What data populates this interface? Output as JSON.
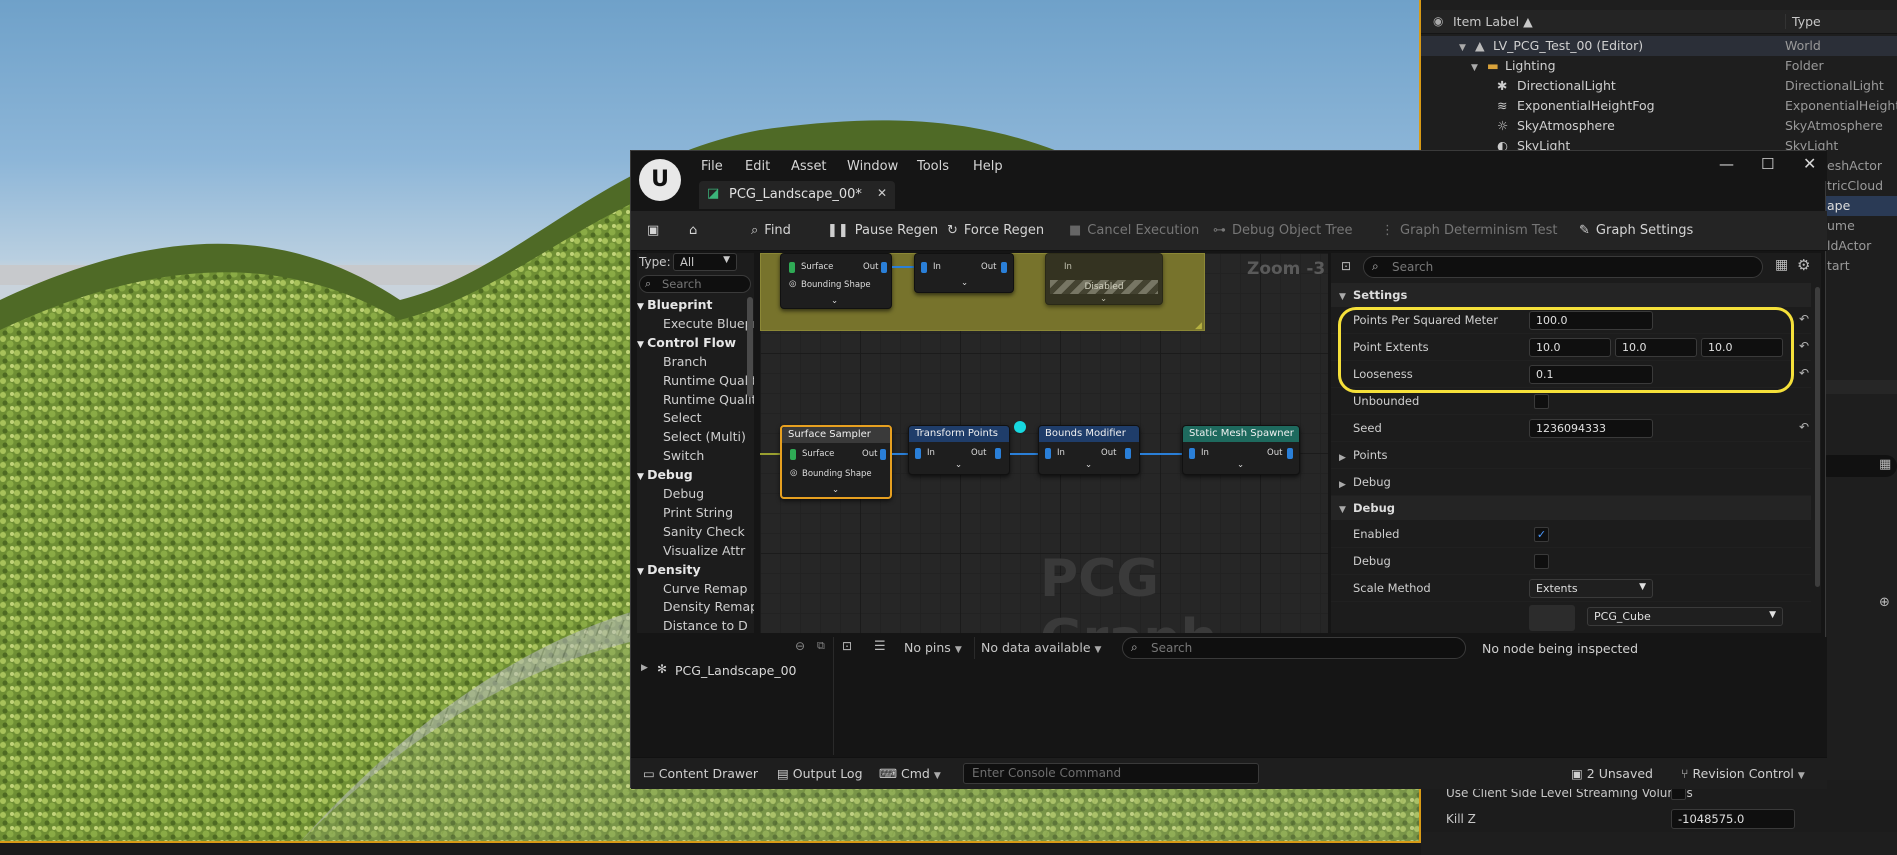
{
  "outliner": {
    "header": {
      "item_label": "Item Label ▲",
      "type": "Type"
    },
    "rows": [
      {
        "label": "LV_PCG_Test_00 (Editor)",
        "type": "World"
      },
      {
        "label": "Lighting",
        "type": "Folder"
      },
      {
        "label": "DirectionalLight",
        "type": "DirectionalLight"
      },
      {
        "label": "ExponentialHeightFog",
        "type": "ExponentialHeightF"
      },
      {
        "label": "SkyAtmosphere",
        "type": "SkyAtmosphere"
      },
      {
        "label": "SkyLight",
        "type": "SkyLight"
      }
    ],
    "partial_types": [
      "eshActor",
      "tricCloud",
      "ape",
      "ume",
      "ldActor",
      "tart"
    ]
  },
  "world_settings": {
    "streaming_label": "Use Client Side Level Streaming Volumes",
    "kill_z_label": "Kill Z",
    "kill_z_value": "-1048575.0"
  },
  "pcg": {
    "menu": [
      "File",
      "Edit",
      "Asset",
      "Window",
      "Tools",
      "Help"
    ],
    "tab_title": "PCG_Landscape_00*",
    "toolbar": {
      "find": "Find",
      "pause": "Pause Regen",
      "force": "Force Regen",
      "cancel": "Cancel Execution",
      "debug_tree": "Debug Object Tree",
      "determinism": "Graph Determinism Test",
      "settings": "Graph Settings"
    },
    "palette": {
      "type_label": "Type:",
      "type_value": "All",
      "search_placeholder": "Search",
      "items": [
        {
          "kind": "cat",
          "label": "Blueprint"
        },
        {
          "kind": "sub",
          "label": "Execute Blueprint"
        },
        {
          "kind": "cat",
          "label": "Control Flow"
        },
        {
          "kind": "sub",
          "label": "Branch"
        },
        {
          "kind": "sub",
          "label": "Runtime Quality"
        },
        {
          "kind": "sub",
          "label": "Runtime Quality"
        },
        {
          "kind": "sub",
          "label": "Select"
        },
        {
          "kind": "sub",
          "label": "Select (Multi)"
        },
        {
          "kind": "sub",
          "label": "Switch"
        },
        {
          "kind": "cat",
          "label": "Debug"
        },
        {
          "kind": "sub",
          "label": "Debug"
        },
        {
          "kind": "sub",
          "label": "Print String"
        },
        {
          "kind": "sub",
          "label": "Sanity Check"
        },
        {
          "kind": "sub",
          "label": "Visualize Attr"
        },
        {
          "kind": "cat",
          "label": "Density"
        },
        {
          "kind": "sub",
          "label": "Curve Remap"
        },
        {
          "kind": "sub",
          "label": "Density Remap"
        },
        {
          "kind": "sub",
          "label": "Distance to D"
        }
      ]
    },
    "graph": {
      "zoom": "Zoom -3",
      "watermark": "PCG Graph",
      "disabled_label": "Disabled",
      "pins": {
        "surface": "Surface",
        "bounding": "Bounding Shape",
        "out": "Out",
        "in": "In"
      },
      "nodes": {
        "surface_sampler": "Surface Sampler",
        "transform_points": "Transform Points",
        "bounds_modifier": "Bounds Modifier",
        "static_mesh_spawner": "Static Mesh Spawner"
      }
    },
    "details": {
      "search_placeholder": "Search",
      "settings_section": "Settings",
      "points_per_sqm_label": "Points Per Squared Meter",
      "points_per_sqm_value": "100.0",
      "point_extents_label": "Point Extents",
      "point_extents_values": [
        "10.0",
        "10.0",
        "10.0"
      ],
      "looseness_label": "Looseness",
      "looseness_value": "0.1",
      "unbounded_label": "Unbounded",
      "seed_label": "Seed",
      "seed_value": "1236094333",
      "points_group": "Points",
      "debug_group": "Debug",
      "debug_section": "Debug",
      "enabled_label": "Enabled",
      "debug_label": "Debug",
      "scale_method_label": "Scale Method",
      "scale_method_value": "Extents",
      "mesh_value": "PCG_Cube"
    },
    "tree": {
      "item": "PCG_Landscape_00"
    },
    "inspector": {
      "pins_dropdown": "No pins",
      "data_dropdown": "No data available",
      "search_placeholder": "Search",
      "status": "No node being inspected"
    },
    "statusbar": {
      "content_drawer": "Content Drawer",
      "output_log": "Output Log",
      "cmd": "Cmd",
      "console_placeholder": "Enter Console Command",
      "unsaved": "2 Unsaved",
      "revision": "Revision Control"
    }
  }
}
